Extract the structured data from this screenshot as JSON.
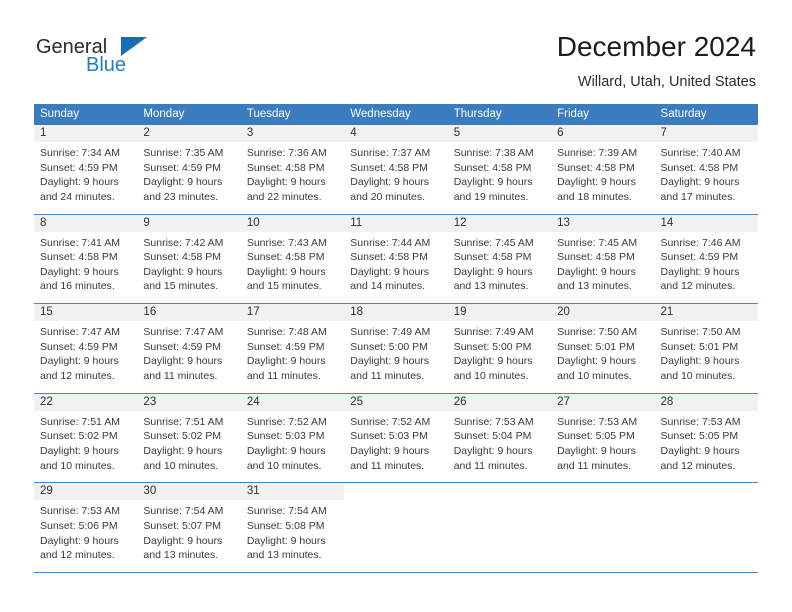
{
  "brand": {
    "name_top": "General",
    "name_bottom": "Blue",
    "triangle_color": "#1a6cb5",
    "blue_color": "#1f7dc4"
  },
  "header": {
    "month_title": "December 2024",
    "location": "Willard, Utah, United States"
  },
  "theme": {
    "header_bar": "#3b7cbf",
    "row_divider": "#4a84c4",
    "daynum_strip": "#f1f1f1",
    "text": "#3a3a3a"
  },
  "weekdays": [
    "Sunday",
    "Monday",
    "Tuesday",
    "Wednesday",
    "Thursday",
    "Friday",
    "Saturday"
  ],
  "weeks": [
    [
      {
        "day": "1",
        "lines": [
          "Sunrise: 7:34 AM",
          "Sunset: 4:59 PM",
          "Daylight: 9 hours",
          "and 24 minutes."
        ]
      },
      {
        "day": "2",
        "lines": [
          "Sunrise: 7:35 AM",
          "Sunset: 4:59 PM",
          "Daylight: 9 hours",
          "and 23 minutes."
        ]
      },
      {
        "day": "3",
        "lines": [
          "Sunrise: 7:36 AM",
          "Sunset: 4:58 PM",
          "Daylight: 9 hours",
          "and 22 minutes."
        ]
      },
      {
        "day": "4",
        "lines": [
          "Sunrise: 7:37 AM",
          "Sunset: 4:58 PM",
          "Daylight: 9 hours",
          "and 20 minutes."
        ]
      },
      {
        "day": "5",
        "lines": [
          "Sunrise: 7:38 AM",
          "Sunset: 4:58 PM",
          "Daylight: 9 hours",
          "and 19 minutes."
        ]
      },
      {
        "day": "6",
        "lines": [
          "Sunrise: 7:39 AM",
          "Sunset: 4:58 PM",
          "Daylight: 9 hours",
          "and 18 minutes."
        ]
      },
      {
        "day": "7",
        "lines": [
          "Sunrise: 7:40 AM",
          "Sunset: 4:58 PM",
          "Daylight: 9 hours",
          "and 17 minutes."
        ]
      }
    ],
    [
      {
        "day": "8",
        "lines": [
          "Sunrise: 7:41 AM",
          "Sunset: 4:58 PM",
          "Daylight: 9 hours",
          "and 16 minutes."
        ]
      },
      {
        "day": "9",
        "lines": [
          "Sunrise: 7:42 AM",
          "Sunset: 4:58 PM",
          "Daylight: 9 hours",
          "and 15 minutes."
        ]
      },
      {
        "day": "10",
        "lines": [
          "Sunrise: 7:43 AM",
          "Sunset: 4:58 PM",
          "Daylight: 9 hours",
          "and 15 minutes."
        ]
      },
      {
        "day": "11",
        "lines": [
          "Sunrise: 7:44 AM",
          "Sunset: 4:58 PM",
          "Daylight: 9 hours",
          "and 14 minutes."
        ]
      },
      {
        "day": "12",
        "lines": [
          "Sunrise: 7:45 AM",
          "Sunset: 4:58 PM",
          "Daylight: 9 hours",
          "and 13 minutes."
        ]
      },
      {
        "day": "13",
        "lines": [
          "Sunrise: 7:45 AM",
          "Sunset: 4:58 PM",
          "Daylight: 9 hours",
          "and 13 minutes."
        ]
      },
      {
        "day": "14",
        "lines": [
          "Sunrise: 7:46 AM",
          "Sunset: 4:59 PM",
          "Daylight: 9 hours",
          "and 12 minutes."
        ]
      }
    ],
    [
      {
        "day": "15",
        "lines": [
          "Sunrise: 7:47 AM",
          "Sunset: 4:59 PM",
          "Daylight: 9 hours",
          "and 12 minutes."
        ]
      },
      {
        "day": "16",
        "lines": [
          "Sunrise: 7:47 AM",
          "Sunset: 4:59 PM",
          "Daylight: 9 hours",
          "and 11 minutes."
        ]
      },
      {
        "day": "17",
        "lines": [
          "Sunrise: 7:48 AM",
          "Sunset: 4:59 PM",
          "Daylight: 9 hours",
          "and 11 minutes."
        ]
      },
      {
        "day": "18",
        "lines": [
          "Sunrise: 7:49 AM",
          "Sunset: 5:00 PM",
          "Daylight: 9 hours",
          "and 11 minutes."
        ]
      },
      {
        "day": "19",
        "lines": [
          "Sunrise: 7:49 AM",
          "Sunset: 5:00 PM",
          "Daylight: 9 hours",
          "and 10 minutes."
        ]
      },
      {
        "day": "20",
        "lines": [
          "Sunrise: 7:50 AM",
          "Sunset: 5:01 PM",
          "Daylight: 9 hours",
          "and 10 minutes."
        ]
      },
      {
        "day": "21",
        "lines": [
          "Sunrise: 7:50 AM",
          "Sunset: 5:01 PM",
          "Daylight: 9 hours",
          "and 10 minutes."
        ]
      }
    ],
    [
      {
        "day": "22",
        "lines": [
          "Sunrise: 7:51 AM",
          "Sunset: 5:02 PM",
          "Daylight: 9 hours",
          "and 10 minutes."
        ]
      },
      {
        "day": "23",
        "lines": [
          "Sunrise: 7:51 AM",
          "Sunset: 5:02 PM",
          "Daylight: 9 hours",
          "and 10 minutes."
        ]
      },
      {
        "day": "24",
        "lines": [
          "Sunrise: 7:52 AM",
          "Sunset: 5:03 PM",
          "Daylight: 9 hours",
          "and 10 minutes."
        ]
      },
      {
        "day": "25",
        "lines": [
          "Sunrise: 7:52 AM",
          "Sunset: 5:03 PM",
          "Daylight: 9 hours",
          "and 11 minutes."
        ]
      },
      {
        "day": "26",
        "lines": [
          "Sunrise: 7:53 AM",
          "Sunset: 5:04 PM",
          "Daylight: 9 hours",
          "and 11 minutes."
        ]
      },
      {
        "day": "27",
        "lines": [
          "Sunrise: 7:53 AM",
          "Sunset: 5:05 PM",
          "Daylight: 9 hours",
          "and 11 minutes."
        ]
      },
      {
        "day": "28",
        "lines": [
          "Sunrise: 7:53 AM",
          "Sunset: 5:05 PM",
          "Daylight: 9 hours",
          "and 12 minutes."
        ]
      }
    ],
    [
      {
        "day": "29",
        "lines": [
          "Sunrise: 7:53 AM",
          "Sunset: 5:06 PM",
          "Daylight: 9 hours",
          "and 12 minutes."
        ]
      },
      {
        "day": "30",
        "lines": [
          "Sunrise: 7:54 AM",
          "Sunset: 5:07 PM",
          "Daylight: 9 hours",
          "and 13 minutes."
        ]
      },
      {
        "day": "31",
        "lines": [
          "Sunrise: 7:54 AM",
          "Sunset: 5:08 PM",
          "Daylight: 9 hours",
          "and 13 minutes."
        ]
      },
      {
        "day": "",
        "lines": []
      },
      {
        "day": "",
        "lines": []
      },
      {
        "day": "",
        "lines": []
      },
      {
        "day": "",
        "lines": []
      }
    ]
  ]
}
